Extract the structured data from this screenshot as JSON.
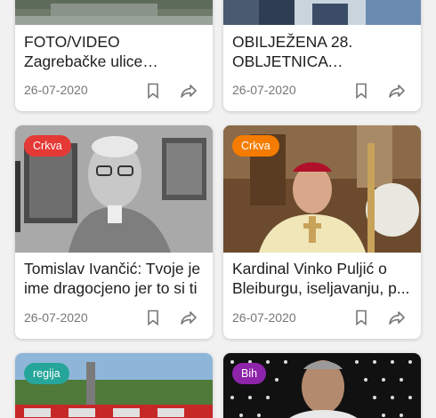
{
  "cards": [
    {
      "title": "FOTO/VIDEO Zagrebačke ulice ponovno pod vodom",
      "date": "26-07-2020"
    },
    {
      "title": "OBILJEŽENA 28. OBLJETNICA NAJBROJNIJE",
      "date": "26-07-2020"
    },
    {
      "category": "Crkva",
      "category_color": "#e53935",
      "title": "Tomislav Ivančić: Tvoje je ime dragocjeno jer to si ti",
      "date": "26-07-2020"
    },
    {
      "category": "Crkva",
      "category_color": "#f57c00",
      "title": "Kardinal Vinko Puljić o Bleiburgu, iseljavanju, p...",
      "date": "26-07-2020"
    },
    {
      "category": "regija",
      "category_color": "#26a69a"
    },
    {
      "category": "Bih",
      "category_color": "#8e24aa"
    }
  ],
  "icons": {
    "bookmark": "bookmark-icon",
    "share": "share-icon"
  }
}
